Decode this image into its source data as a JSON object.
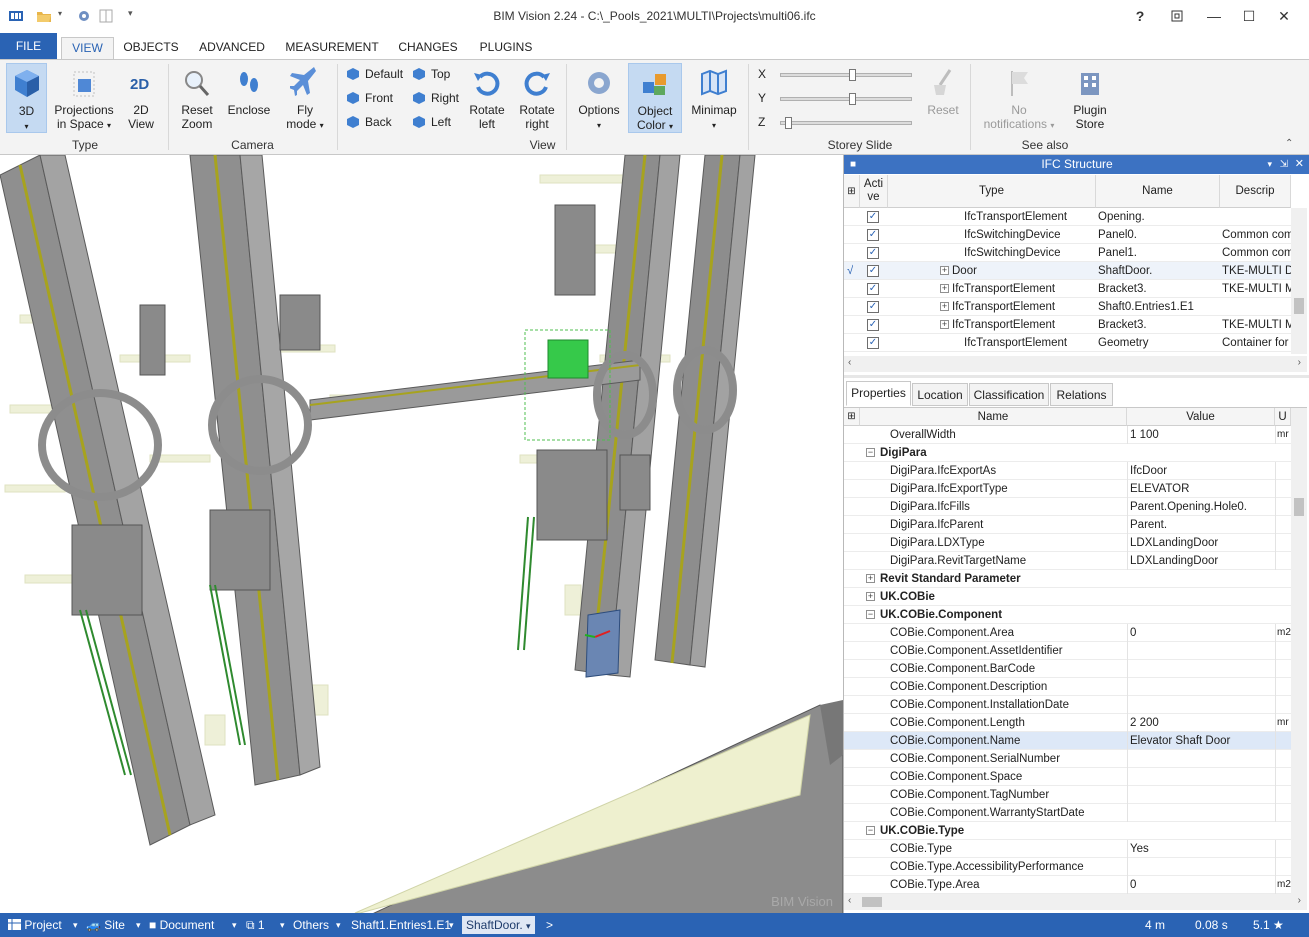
{
  "window": {
    "title": "BIM Vision 2.24 - C:\\_Pools_2021\\MULTI\\Projects\\multi06.ifc",
    "help": "?",
    "restore_icon": "restore-icon",
    "minimize": "—",
    "maximize": "☐",
    "close": "✕"
  },
  "tabs": [
    "FILE",
    "VIEW",
    "OBJECTS",
    "ADVANCED",
    "MEASUREMENT",
    "CHANGES",
    "PLUGINS"
  ],
  "ribbon": {
    "type_group": {
      "label": "Type",
      "btn_3d": "3D",
      "btn_projections_1": "Projections",
      "btn_projections_2": "in Space",
      "btn_2d_1": "2D",
      "btn_2d_2": "View"
    },
    "camera_group": {
      "label": "Camera",
      "reset_zoom_1": "Reset",
      "reset_zoom_2": "Zoom",
      "enclose": "Enclose",
      "fly_1": "Fly",
      "fly_2": "mode"
    },
    "view_group": {
      "label": "View",
      "default": "Default",
      "front": "Front",
      "back": "Back",
      "top": "Top",
      "right": "Right",
      "left": "Left",
      "rotate_left_1": "Rotate",
      "rotate_left_2": "left",
      "rotate_right_1": "Rotate",
      "rotate_right_2": "right"
    },
    "misc": {
      "options": "Options",
      "object_color_1": "Object",
      "object_color_2": "Color",
      "minimap": "Minimap"
    },
    "storey_group": {
      "label": "Storey Slide",
      "x": "X",
      "y": "Y",
      "z": "Z",
      "reset": "Reset",
      "x_level": 0.55,
      "y_level": 0.55,
      "z_level": 0.03
    },
    "see_also": {
      "label": "See also",
      "notifications_1": "No",
      "notifications_2": "notifications",
      "plugin_1": "Plugin",
      "plugin_2": "Store"
    }
  },
  "viewport": {
    "watermark": "BIM Vision"
  },
  "ifc_structure": {
    "title": "IFC Structure",
    "columns": {
      "active_1": "Acti",
      "active_2": "ve",
      "type": "Type",
      "name": "Name",
      "description": "Descrip"
    },
    "rows": [
      {
        "type": "IfcTransportElement",
        "name": "Opening.",
        "desc": "",
        "expand": false
      },
      {
        "type": "IfcSwitchingDevice",
        "name": "Panel0.",
        "desc": "Common comp",
        "expand": false
      },
      {
        "type": "IfcSwitchingDevice",
        "name": "Panel1.",
        "desc": "Common comp",
        "expand": false
      },
      {
        "type": "Door",
        "name": "ShaftDoor.",
        "desc": "TKE-MULTI Do",
        "expand": true,
        "current": "√"
      },
      {
        "type": "IfcTransportElement",
        "name": "Bracket3.",
        "desc": "TKE-MULTI Me",
        "expand": true
      },
      {
        "type": "IfcTransportElement",
        "name": "Shaft0.Entries1.E1",
        "desc": "",
        "expand": true
      },
      {
        "type": "IfcTransportElement",
        "name": "Bracket3.",
        "desc": "TKE-MULTI Me",
        "expand": true
      },
      {
        "type": "IfcTransportElement",
        "name": "Geometry",
        "desc": "Container for I",
        "expand": false
      }
    ]
  },
  "property_tabs": [
    "Properties",
    "Location",
    "Classification",
    "Relations"
  ],
  "properties": {
    "columns": {
      "name": "Name",
      "value": "Value",
      "unit": "U"
    },
    "rows": [
      {
        "kind": "prop",
        "name": "OverallWidth",
        "value": "1 100",
        "unit": "mr"
      },
      {
        "kind": "section",
        "name": "DigiPara",
        "open": true
      },
      {
        "kind": "prop",
        "name": "DigiPara.IfcExportAs",
        "value": "IfcDoor",
        "unit": ""
      },
      {
        "kind": "prop",
        "name": "DigiPara.IfcExportType",
        "value": "ELEVATOR",
        "unit": ""
      },
      {
        "kind": "prop",
        "name": "DigiPara.IfcFills",
        "value": "Parent.Opening.Hole0.",
        "unit": ""
      },
      {
        "kind": "prop",
        "name": "DigiPara.IfcParent",
        "value": "Parent.",
        "unit": ""
      },
      {
        "kind": "prop",
        "name": "DigiPara.LDXType",
        "value": "LDXLandingDoor",
        "unit": ""
      },
      {
        "kind": "prop",
        "name": "DigiPara.RevitTargetName",
        "value": "LDXLandingDoor",
        "unit": ""
      },
      {
        "kind": "section",
        "name": "Revit Standard Parameter",
        "open": false
      },
      {
        "kind": "section",
        "name": "UK.COBie",
        "open": false
      },
      {
        "kind": "section",
        "name": "UK.COBie.Component",
        "open": true
      },
      {
        "kind": "prop",
        "name": "COBie.Component.Area",
        "value": "0",
        "unit": "m2"
      },
      {
        "kind": "prop",
        "name": "COBie.Component.AssetIdentifier",
        "value": "",
        "unit": ""
      },
      {
        "kind": "prop",
        "name": "COBie.Component.BarCode",
        "value": "",
        "unit": ""
      },
      {
        "kind": "prop",
        "name": "COBie.Component.Description",
        "value": "",
        "unit": ""
      },
      {
        "kind": "prop",
        "name": "COBie.Component.InstallationDate",
        "value": "",
        "unit": ""
      },
      {
        "kind": "prop",
        "name": "COBie.Component.Length",
        "value": "2 200",
        "unit": "mr"
      },
      {
        "kind": "prop",
        "name": "COBie.Component.Name",
        "value": "Elevator Shaft Door",
        "unit": "",
        "highlight": true
      },
      {
        "kind": "prop",
        "name": "COBie.Component.SerialNumber",
        "value": "",
        "unit": ""
      },
      {
        "kind": "prop",
        "name": "COBie.Component.Space",
        "value": "",
        "unit": ""
      },
      {
        "kind": "prop",
        "name": "COBie.Component.TagNumber",
        "value": "",
        "unit": ""
      },
      {
        "kind": "prop",
        "name": "COBie.Component.WarrantyStartDate",
        "value": "",
        "unit": ""
      },
      {
        "kind": "section",
        "name": "UK.COBie.Type",
        "open": true
      },
      {
        "kind": "prop",
        "name": "COBie.Type",
        "value": "Yes",
        "unit": ""
      },
      {
        "kind": "prop",
        "name": "COBie.Type.AccessibilityPerformance",
        "value": "",
        "unit": ""
      },
      {
        "kind": "prop",
        "name": "COBie.Type.Area",
        "value": "0",
        "unit": "m2"
      }
    ]
  },
  "statusbar": {
    "project": "Project",
    "site": "Site",
    "document": "Document",
    "storey": "1",
    "others": "Others",
    "entries": "Shaft1.Entries1.E1",
    "shaftdoor": "ShaftDoor.",
    "more": ">",
    "distance": "4 m",
    "time": "0.08 s",
    "version": "5.1 ★"
  }
}
